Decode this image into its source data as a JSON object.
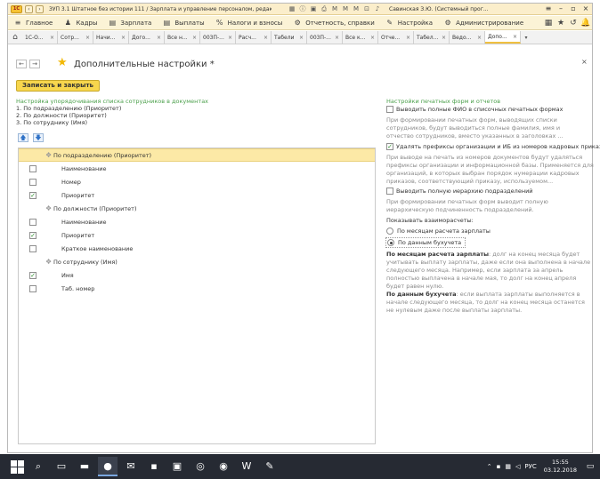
{
  "window": {
    "app_logo": "1С",
    "title": "ЗУП 3.1 Штатное без истории 111 / Зарплата и управление персоналом, редакция 3.1 (1С:Предприятие)",
    "user": "Савинская З.Ю. (Системный прог...",
    "toolbar_icons": [
      "grid-icon",
      "info-icon",
      "save-icon",
      "print-icon",
      "m-icon",
      "m-plus-icon",
      "m-minus-icon",
      "open-icon",
      "bell-icon",
      "menu-icon"
    ]
  },
  "menu": {
    "items": [
      {
        "icon": "≡",
        "label": "Главное"
      },
      {
        "icon": "♟",
        "label": "Кадры"
      },
      {
        "icon": "▤",
        "label": "Зарплата"
      },
      {
        "icon": "▤",
        "label": "Выплаты"
      },
      {
        "icon": "%",
        "label": "Налоги и взносы"
      },
      {
        "icon": "⚙",
        "label": "Отчетность, справки"
      },
      {
        "icon": "✎",
        "label": "Настройка"
      },
      {
        "icon": "⚙",
        "label": "Администрирование"
      }
    ]
  },
  "tabs": [
    {
      "label": "1С-О..."
    },
    {
      "label": "Сотр..."
    },
    {
      "label": "Начи..."
    },
    {
      "label": "Дого..."
    },
    {
      "label": "Все н..."
    },
    {
      "label": "003П-..."
    },
    {
      "label": "Расч..."
    },
    {
      "label": "Табели"
    },
    {
      "label": "003П-..."
    },
    {
      "label": "Все к..."
    },
    {
      "label": "Отче..."
    },
    {
      "label": "Табел..."
    },
    {
      "label": "Ведо..."
    },
    {
      "label": "Допо..."
    }
  ],
  "form": {
    "title": "Дополнительные настройки *",
    "save_close": "Записать и закрыть"
  },
  "left": {
    "header": "Настройка упорядочивания списка сотрудников в документах",
    "order": [
      "1. По подразделению (Приоритет)",
      "2. По должности (Приоритет)",
      "3. По сотруднику (Имя)"
    ]
  },
  "tree": [
    {
      "type": "group",
      "label": "По подразделению (Приоритет)",
      "selected": true
    },
    {
      "type": "item",
      "label": "Наименование",
      "checked": false
    },
    {
      "type": "item",
      "label": "Номер",
      "checked": false
    },
    {
      "type": "item",
      "label": "Приоритет",
      "checked": true
    },
    {
      "type": "group",
      "label": "По должности (Приоритет)",
      "selected": false
    },
    {
      "type": "item",
      "label": "Наименование",
      "checked": false
    },
    {
      "type": "item",
      "label": "Приоритет",
      "checked": true
    },
    {
      "type": "item",
      "label": "Краткое наименование",
      "checked": false
    },
    {
      "type": "group",
      "label": "По сотруднику (Имя)",
      "selected": false
    },
    {
      "type": "item",
      "label": "Имя",
      "checked": true
    },
    {
      "type": "item",
      "label": "Таб. номер",
      "checked": false
    }
  ],
  "right": {
    "header": "Настройки печатных форм и отчетов",
    "opt1": {
      "label": "Выводить полные ФИО в списочных печатных формах",
      "checked": false,
      "desc": [
        "При формировании печатных форм, выводящих списки",
        "сотрудников, будут выводиться полные фамилия, имя и",
        "отчество сотрудников, вместо указанных в заголовках ..."
      ]
    },
    "opt2": {
      "label": "Удалять префиксы организации и ИБ из номеров кадровых приказов",
      "checked": true,
      "desc": [
        "При выводе на печать из номеров документов будут удаляться",
        "префиксы организации и информационной базы. Применяется для",
        "организаций, в которых выбран порядок нумерации кадровых",
        "приказов, соответствующий приказу, используемом..."
      ]
    },
    "opt3": {
      "label": "Выводить полную иерархию подразделений",
      "checked": false,
      "desc": [
        "При формировании печатных форм выводит полную",
        "иерархическую подчиненность подразделений."
      ]
    },
    "mutual_label": "Показывать взаиморасчеты:",
    "radio1": "По месяцам расчета зарплаты",
    "radio2": "По данным бухучета",
    "note1_bold": "По месяцам расчета зарплаты",
    "note1": [
      ": долг на конец месяца будет",
      "учитывать выплату зарплаты, даже если она выполнена в начале",
      "следующего месяца. Например, если зарплата за апрель",
      "полностью выплачена в начале мая, то долг на конец апреля",
      "будет равен нулю."
    ],
    "note2_bold": "По данным бухучета",
    "note2": [
      ": если выплата зарплаты выполняется в",
      "начале следующего месяца, то долг на конец месяца останется",
      "не нулевым даже после выплаты зарплаты."
    ]
  },
  "taskbar": {
    "lang": "РУС",
    "time": "15:55",
    "date": "03.12.2018"
  }
}
